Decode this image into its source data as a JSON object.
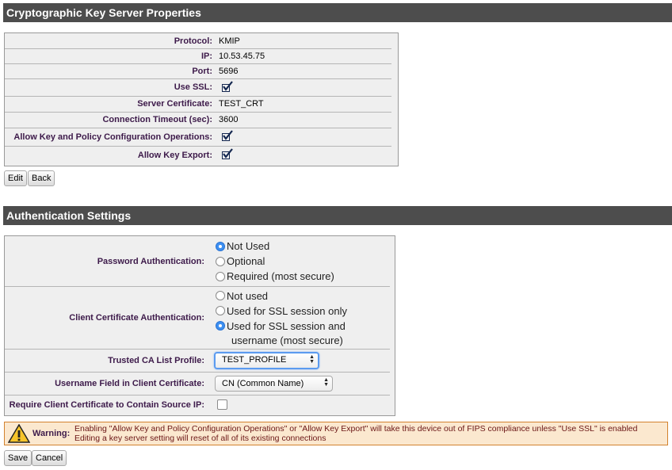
{
  "key_server": {
    "title": "Cryptographic Key Server Properties",
    "fields": [
      {
        "label": "Protocol:",
        "value": "KMIP"
      },
      {
        "label": "IP:",
        "value": "10.53.45.75"
      },
      {
        "label": "Port:",
        "value": "5696"
      },
      {
        "label": "Use SSL:",
        "checked": true
      },
      {
        "label": "Server Certificate:",
        "value": "TEST_CRT"
      },
      {
        "label": "Connection Timeout (sec):",
        "value": "3600"
      },
      {
        "label": "Allow Key and Policy Configuration Operations:",
        "checked": true
      },
      {
        "label": "Allow Key Export:",
        "checked": true
      }
    ],
    "edit_label": "Edit",
    "back_label": "Back"
  },
  "auth": {
    "title": "Authentication Settings",
    "password": {
      "label": "Password Authentication:",
      "options": [
        "Not Used",
        "Optional",
        "Required (most secure)"
      ],
      "selected": 0
    },
    "client_cert": {
      "label": "Client Certificate Authentication:",
      "options": [
        "Not used",
        "Used for SSL session only",
        "Used for SSL session and",
        "username (most secure)"
      ],
      "selected": 2
    },
    "trusted_ca": {
      "label": "Trusted CA List Profile:",
      "value": "TEST_PROFILE"
    },
    "username_field": {
      "label": "Username Field in Client Certificate:",
      "value": "CN (Common Name)"
    },
    "require_source_ip": {
      "label": "Require Client Certificate to Contain Source IP:",
      "checked": false
    }
  },
  "warning": {
    "label": "Warning:",
    "line1": "Enabling \"Allow Key and Policy Configuration Operations\" or \"Allow Key Export\" will take this device out of FIPS compliance unless \"Use SSL\" is enabled",
    "line2": "Editing a key server setting will reset of all of its existing connections"
  },
  "footer": {
    "save_label": "Save",
    "cancel_label": "Cancel"
  },
  "colors": {
    "header_bg": "#4d4d4d",
    "label": "#3d1a4a",
    "radio_on": "#3d8ff1",
    "warning_bg": "#fbe8cf"
  }
}
